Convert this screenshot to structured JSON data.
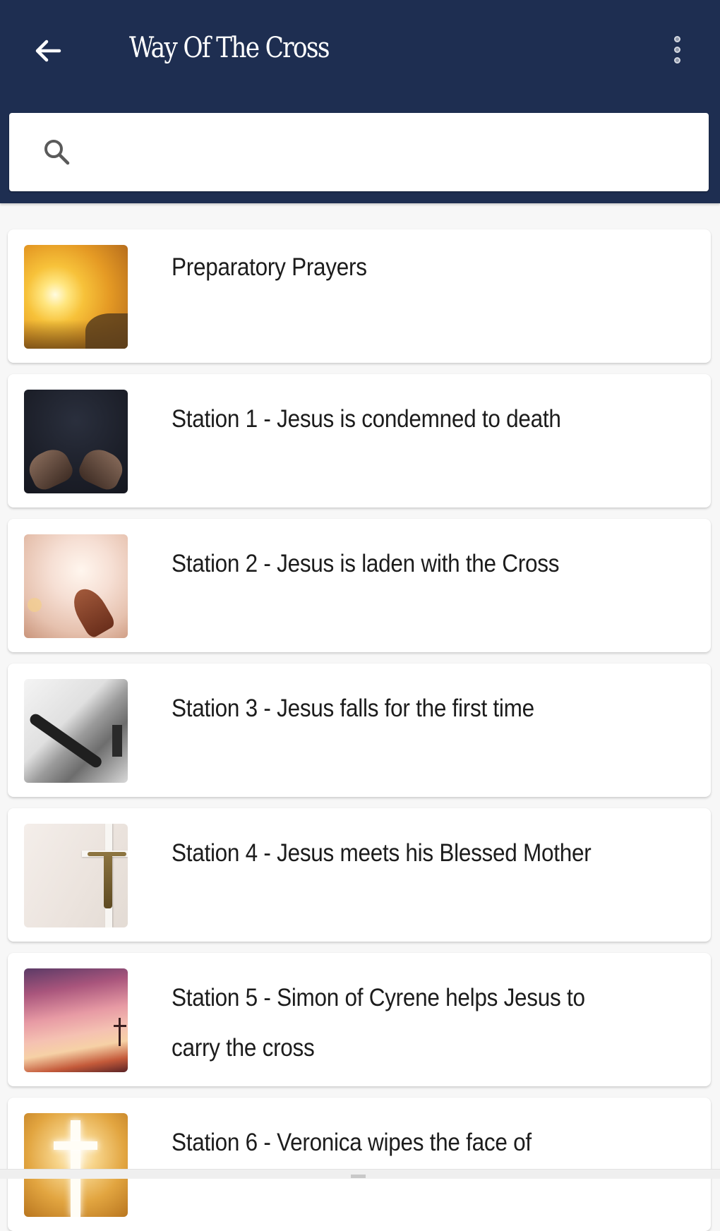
{
  "appbar": {
    "title": "Way Of The Cross",
    "back_icon": "arrow-back-icon",
    "overflow_icon": "more-vertical-icon",
    "background_color": "#1e2e51"
  },
  "search": {
    "icon": "search-icon",
    "value": "",
    "placeholder": ""
  },
  "items": [
    {
      "label": "Preparatory Prayers",
      "thumbnail": "sunset-praying-figure-image"
    },
    {
      "label": "Station 1 - Jesus is condemned to death",
      "thumbnail": "hands-raised-dark-image"
    },
    {
      "label": "Station 2 - Jesus is laden with the Cross",
      "thumbnail": "hand-in-light-image"
    },
    {
      "label": "Station 3 - Jesus falls for the first time",
      "thumbnail": "rosary-on-bible-image"
    },
    {
      "label": "Station 4 - Jesus meets his Blessed Mother",
      "thumbnail": "crucifix-on-wall-image"
    },
    {
      "label": "Station 5 - Simon of Cyrene helps Jesus to carry the cross",
      "thumbnail": "pink-sky-crosses-image"
    },
    {
      "label": "Station 6 - Veronica wipes the face of",
      "thumbnail": "glowing-cross-image"
    }
  ]
}
